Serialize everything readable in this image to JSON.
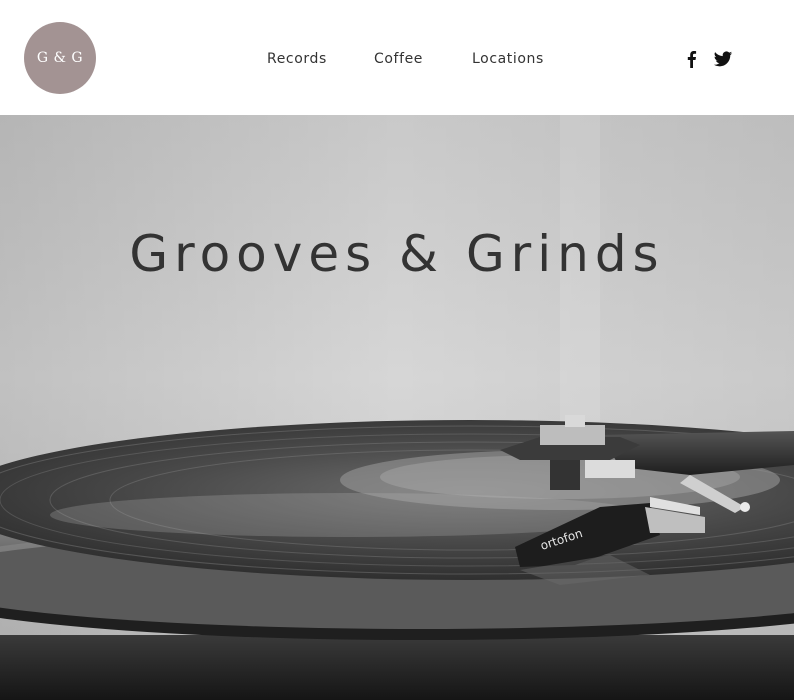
{
  "header": {
    "logo_text": "G & G",
    "nav": [
      {
        "label": "Records"
      },
      {
        "label": "Coffee"
      },
      {
        "label": "Locations"
      }
    ],
    "social": [
      {
        "icon": "facebook-icon"
      },
      {
        "icon": "twitter-icon"
      }
    ]
  },
  "hero": {
    "title": "Grooves & Grinds",
    "image": "turntable-with-vinyl-record",
    "cartridge_text": "ortofon"
  },
  "colors": {
    "logo_bg": "#a39393",
    "text": "#333333",
    "header_bg": "#ffffff"
  }
}
